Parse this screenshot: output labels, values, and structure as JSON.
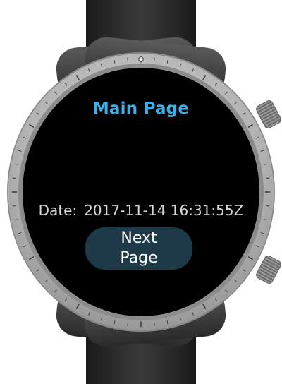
{
  "app": {
    "page_title": "Main Page"
  },
  "date": {
    "label": "Date:",
    "value": "2017-11-14 16:31:55Z"
  },
  "button": {
    "next_label": "Next Page"
  },
  "colors": {
    "title": "#3ab0e8",
    "screen_bg": "#000000",
    "button_bg": "#1e3a49",
    "date_text": "#d8d8d8"
  },
  "icons": {
    "crown_top": "crown-button-icon",
    "crown_bottom": "crown-button-icon"
  }
}
